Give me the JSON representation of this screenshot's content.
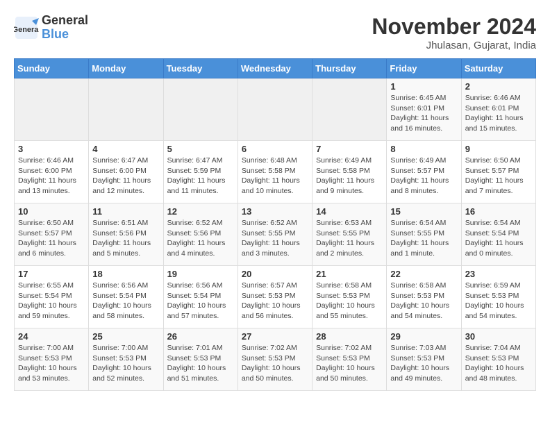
{
  "header": {
    "logo_text_general": "General",
    "logo_text_blue": "Blue",
    "month_title": "November 2024",
    "location": "Jhulasan, Gujarat, India"
  },
  "weekdays": [
    "Sunday",
    "Monday",
    "Tuesday",
    "Wednesday",
    "Thursday",
    "Friday",
    "Saturday"
  ],
  "weeks": [
    [
      {
        "day": "",
        "info": ""
      },
      {
        "day": "",
        "info": ""
      },
      {
        "day": "",
        "info": ""
      },
      {
        "day": "",
        "info": ""
      },
      {
        "day": "",
        "info": ""
      },
      {
        "day": "1",
        "info": "Sunrise: 6:45 AM\nSunset: 6:01 PM\nDaylight: 11 hours and 16 minutes."
      },
      {
        "day": "2",
        "info": "Sunrise: 6:46 AM\nSunset: 6:01 PM\nDaylight: 11 hours and 15 minutes."
      }
    ],
    [
      {
        "day": "3",
        "info": "Sunrise: 6:46 AM\nSunset: 6:00 PM\nDaylight: 11 hours and 13 minutes."
      },
      {
        "day": "4",
        "info": "Sunrise: 6:47 AM\nSunset: 6:00 PM\nDaylight: 11 hours and 12 minutes."
      },
      {
        "day": "5",
        "info": "Sunrise: 6:47 AM\nSunset: 5:59 PM\nDaylight: 11 hours and 11 minutes."
      },
      {
        "day": "6",
        "info": "Sunrise: 6:48 AM\nSunset: 5:58 PM\nDaylight: 11 hours and 10 minutes."
      },
      {
        "day": "7",
        "info": "Sunrise: 6:49 AM\nSunset: 5:58 PM\nDaylight: 11 hours and 9 minutes."
      },
      {
        "day": "8",
        "info": "Sunrise: 6:49 AM\nSunset: 5:57 PM\nDaylight: 11 hours and 8 minutes."
      },
      {
        "day": "9",
        "info": "Sunrise: 6:50 AM\nSunset: 5:57 PM\nDaylight: 11 hours and 7 minutes."
      }
    ],
    [
      {
        "day": "10",
        "info": "Sunrise: 6:50 AM\nSunset: 5:57 PM\nDaylight: 11 hours and 6 minutes."
      },
      {
        "day": "11",
        "info": "Sunrise: 6:51 AM\nSunset: 5:56 PM\nDaylight: 11 hours and 5 minutes."
      },
      {
        "day": "12",
        "info": "Sunrise: 6:52 AM\nSunset: 5:56 PM\nDaylight: 11 hours and 4 minutes."
      },
      {
        "day": "13",
        "info": "Sunrise: 6:52 AM\nSunset: 5:55 PM\nDaylight: 11 hours and 3 minutes."
      },
      {
        "day": "14",
        "info": "Sunrise: 6:53 AM\nSunset: 5:55 PM\nDaylight: 11 hours and 2 minutes."
      },
      {
        "day": "15",
        "info": "Sunrise: 6:54 AM\nSunset: 5:55 PM\nDaylight: 11 hours and 1 minute."
      },
      {
        "day": "16",
        "info": "Sunrise: 6:54 AM\nSunset: 5:54 PM\nDaylight: 11 hours and 0 minutes."
      }
    ],
    [
      {
        "day": "17",
        "info": "Sunrise: 6:55 AM\nSunset: 5:54 PM\nDaylight: 10 hours and 59 minutes."
      },
      {
        "day": "18",
        "info": "Sunrise: 6:56 AM\nSunset: 5:54 PM\nDaylight: 10 hours and 58 minutes."
      },
      {
        "day": "19",
        "info": "Sunrise: 6:56 AM\nSunset: 5:54 PM\nDaylight: 10 hours and 57 minutes."
      },
      {
        "day": "20",
        "info": "Sunrise: 6:57 AM\nSunset: 5:53 PM\nDaylight: 10 hours and 56 minutes."
      },
      {
        "day": "21",
        "info": "Sunrise: 6:58 AM\nSunset: 5:53 PM\nDaylight: 10 hours and 55 minutes."
      },
      {
        "day": "22",
        "info": "Sunrise: 6:58 AM\nSunset: 5:53 PM\nDaylight: 10 hours and 54 minutes."
      },
      {
        "day": "23",
        "info": "Sunrise: 6:59 AM\nSunset: 5:53 PM\nDaylight: 10 hours and 54 minutes."
      }
    ],
    [
      {
        "day": "24",
        "info": "Sunrise: 7:00 AM\nSunset: 5:53 PM\nDaylight: 10 hours and 53 minutes."
      },
      {
        "day": "25",
        "info": "Sunrise: 7:00 AM\nSunset: 5:53 PM\nDaylight: 10 hours and 52 minutes."
      },
      {
        "day": "26",
        "info": "Sunrise: 7:01 AM\nSunset: 5:53 PM\nDaylight: 10 hours and 51 minutes."
      },
      {
        "day": "27",
        "info": "Sunrise: 7:02 AM\nSunset: 5:53 PM\nDaylight: 10 hours and 50 minutes."
      },
      {
        "day": "28",
        "info": "Sunrise: 7:02 AM\nSunset: 5:53 PM\nDaylight: 10 hours and 50 minutes."
      },
      {
        "day": "29",
        "info": "Sunrise: 7:03 AM\nSunset: 5:53 PM\nDaylight: 10 hours and 49 minutes."
      },
      {
        "day": "30",
        "info": "Sunrise: 7:04 AM\nSunset: 5:53 PM\nDaylight: 10 hours and 48 minutes."
      }
    ]
  ]
}
